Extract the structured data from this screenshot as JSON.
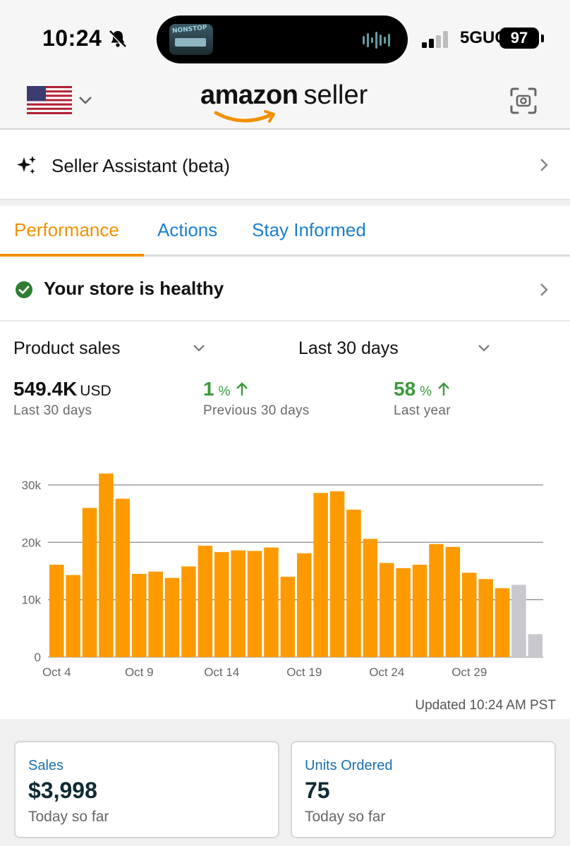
{
  "status_bar": {
    "time": "10:24",
    "network": "5GUC",
    "battery": "97",
    "island_art_text": "NONSTOP"
  },
  "header": {
    "logo_amazon": "amazon",
    "logo_seller": "seller"
  },
  "assistant": {
    "label": "Seller Assistant (beta)"
  },
  "tabs": [
    {
      "label": "Performance",
      "active": true
    },
    {
      "label": "Actions",
      "active": false
    },
    {
      "label": "Stay Informed",
      "active": false
    }
  ],
  "health": {
    "label": "Your store is healthy"
  },
  "filters": {
    "metric": "Product sales",
    "period": "Last 30 days"
  },
  "stats": [
    {
      "value": "549.4K",
      "unit": "USD",
      "sub": "Last 30 days"
    },
    {
      "value": "1",
      "unit": "%",
      "sub": "Previous 30 days"
    },
    {
      "value": "58",
      "unit": "%",
      "sub": "Last year"
    }
  ],
  "colors": {
    "accent": "#f29100",
    "link": "#1a7fcf",
    "green": "#3a9a3d",
    "bar": "#fd9a00",
    "bar_pending": "#c9c8ce"
  },
  "chart_data": {
    "type": "bar",
    "categories": [
      "Oct 4",
      "Oct 5",
      "Oct 6",
      "Oct 7",
      "Oct 8",
      "Oct 9",
      "Oct 10",
      "Oct 11",
      "Oct 12",
      "Oct 13",
      "Oct 14",
      "Oct 15",
      "Oct 16",
      "Oct 17",
      "Oct 18",
      "Oct 19",
      "Oct 20",
      "Oct 21",
      "Oct 22",
      "Oct 23",
      "Oct 24",
      "Oct 25",
      "Oct 26",
      "Oct 27",
      "Oct 28",
      "Oct 29",
      "Oct 30",
      "Oct 31",
      "Nov 1",
      "Nov 2"
    ],
    "values": [
      16100,
      14300,
      26000,
      32000,
      27600,
      14500,
      14900,
      13800,
      15800,
      19400,
      18300,
      18600,
      18500,
      19100,
      14000,
      18100,
      28600,
      28900,
      25700,
      20600,
      16400,
      15500,
      16100,
      19700,
      19200,
      14700,
      13600,
      12000,
      12600,
      4000
    ],
    "pending": [
      false,
      false,
      false,
      false,
      false,
      false,
      false,
      false,
      false,
      false,
      false,
      false,
      false,
      false,
      false,
      false,
      false,
      false,
      false,
      false,
      false,
      false,
      false,
      false,
      false,
      false,
      false,
      false,
      true,
      true
    ],
    "x_tick_labels": [
      "Oct 4",
      "Oct 9",
      "Oct 14",
      "Oct 19",
      "Oct 24",
      "Oct 29"
    ],
    "y_ticks": [
      0,
      10000,
      20000,
      30000
    ],
    "y_tick_labels": [
      "0",
      "10k",
      "20k",
      "30k"
    ],
    "ylim": [
      0,
      30000
    ],
    "grid": true
  },
  "updated": "Updated 10:24 AM PST",
  "cards": [
    {
      "label": "Sales",
      "value": "$3,998",
      "sub": "Today so far"
    },
    {
      "label": "Units Ordered",
      "value": "75",
      "sub": "Today so far"
    }
  ]
}
